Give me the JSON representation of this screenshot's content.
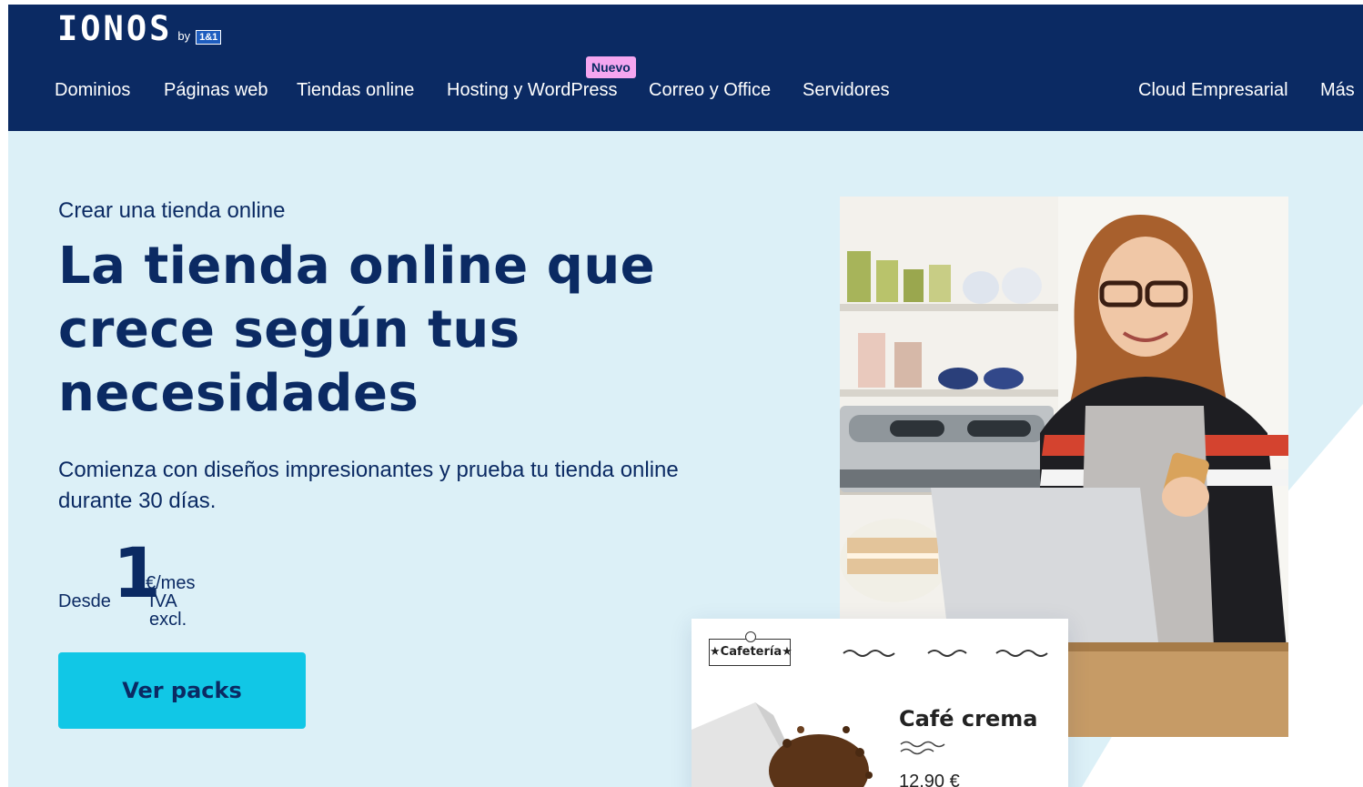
{
  "header": {
    "logo_text": "IONOS",
    "logo_by": "by",
    "logo_brand": "1&1",
    "nav": [
      {
        "label": "Dominios"
      },
      {
        "label": "Páginas web"
      },
      {
        "label": "Tiendas online"
      },
      {
        "label": "Hosting y WordPress",
        "badge": "Nuevo"
      },
      {
        "label": "Correo y Office"
      },
      {
        "label": "Servidores"
      },
      {
        "label": "Cloud Empresarial"
      },
      {
        "label": "Más"
      }
    ]
  },
  "hero": {
    "eyebrow": "Crear una tienda online",
    "headline": "La tienda online que crece según tus necesidades",
    "subtext": "Comienza con diseños impresionantes y prueba tu tienda online durante 30 días.",
    "price": {
      "prefix": "Desde",
      "amount": "1",
      "unit": "€/mes",
      "tax_note": "IVA excl."
    },
    "cta_label": "Ver packs"
  },
  "product_card": {
    "shop_logo": "★Cafetería★",
    "product_name": "Café crema",
    "product_price": "12,90 €"
  },
  "colors": {
    "navy": "#0b2a63",
    "hero_bg": "#dcf0f7",
    "cta": "#11c7e6",
    "badge": "#f5a6f0"
  },
  "icons": [
    "ionos-logo",
    "woman-with-phone-photo",
    "coffee-bag-image"
  ]
}
